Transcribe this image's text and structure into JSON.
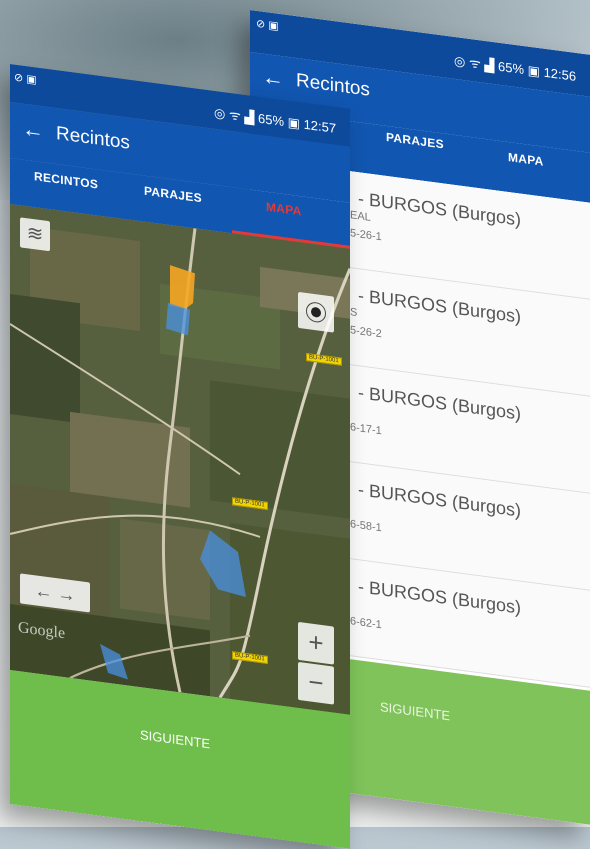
{
  "back": {
    "status": {
      "icons": "⊘ ▣",
      "right": "◎ ᯤ ▟ 65% ▣ 12:56"
    },
    "appbar": {
      "title": "Recintos"
    },
    "tabs": [
      "PARAJES",
      "MAPA"
    ],
    "list": [
      {
        "title": "- BURGOS (Burgos)",
        "sub1": "EAL",
        "sub2": "5-26-1"
      },
      {
        "title": "- BURGOS (Burgos)",
        "sub1": "S",
        "sub2": "5-26-2"
      },
      {
        "title": "- BURGOS (Burgos)",
        "sub1": "",
        "sub2": "6-17-1"
      },
      {
        "title": "- BURGOS (Burgos)",
        "sub1": "",
        "sub2": "6-58-1"
      },
      {
        "title": "- BURGOS (Burgos)",
        "sub1": "",
        "sub2": "6-62-1"
      }
    ],
    "next_label": "SIGUIENTE"
  },
  "front": {
    "status": {
      "icons": "⊘ ▣",
      "right": "◎ ᯤ ▟ 65% ▣ 12:57"
    },
    "appbar": {
      "title": "Recintos"
    },
    "tabs": [
      "RECINTOS",
      "PARAJES",
      "MAPA"
    ],
    "map": {
      "watermark": "Google",
      "road_labels": [
        "BU-P-1001",
        "BU-P-1001",
        "BU-P-1001"
      ],
      "zoom_in": "+",
      "zoom_out": "−",
      "arrows": "← →"
    },
    "next_label": "SIGUIENTE"
  },
  "colors": {
    "primary": "#1156b0",
    "accent": "#e53935",
    "green": "#6fbd4a",
    "parcel_orange": "#f5a623",
    "parcel_blue": "#4a90e2"
  }
}
